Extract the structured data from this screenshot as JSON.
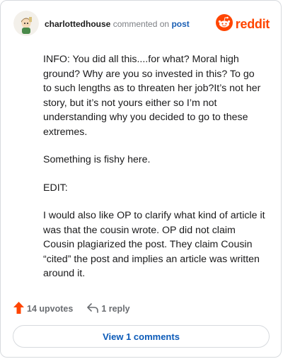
{
  "comment": {
    "username": "charlottedhouse",
    "action_text": "commented on",
    "post_link": "post",
    "paragraphs": [
      "INFO: You did all this....for what? Moral high ground? Why are you so invested in this? To go to such lengths as to threaten her job?It’s not her story, but it’s not yours either so I’m not understanding why you decided to go to these extremes.",
      "Something is fishy here.",
      "EDIT:",
      "I would also like OP to clarify what kind of article it was that the cousin wrote. OP did not claim Cousin plagiarized the post. They claim Cousin “cited” the post and implies an article was written around it."
    ]
  },
  "brand": {
    "wordmark": "reddit",
    "icon": "reddit-snoo-icon",
    "color": "#ff4500"
  },
  "actions": {
    "upvote_icon": "upvote-arrow-icon",
    "upvotes_label": "14 upvotes",
    "reply_icon": "reply-arrow-icon",
    "reply_label": "1 reply"
  },
  "view_comments_label": "View 1 comments",
  "colors": {
    "upvote": "#ff4500",
    "link": "#1a5fb4",
    "text": "#1a1a1b"
  }
}
